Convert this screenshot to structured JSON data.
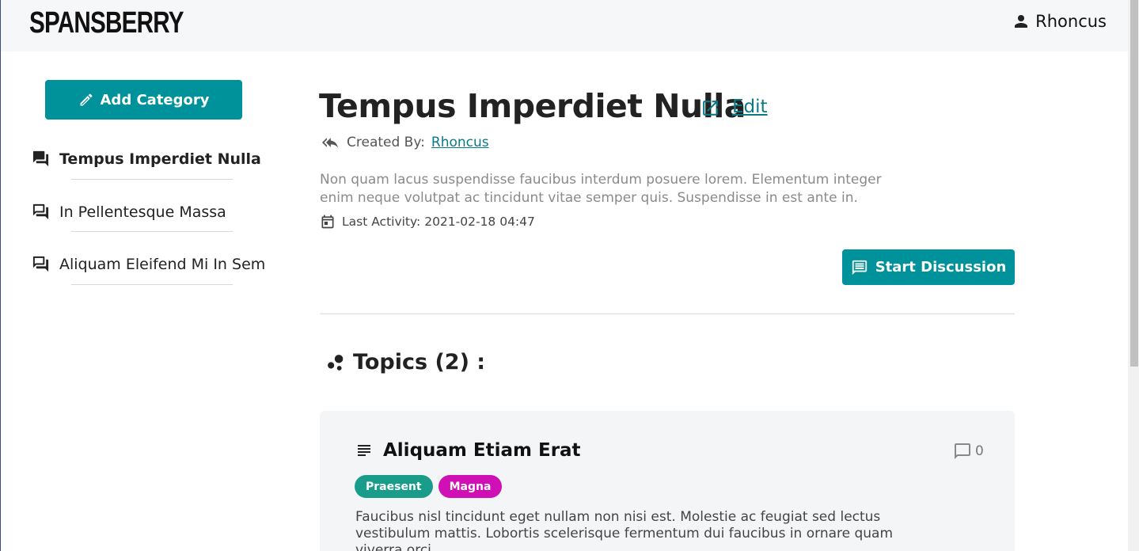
{
  "header": {
    "logo": "SPANSBERRY",
    "username": "Rhoncus"
  },
  "sidebar": {
    "add_category_label": "Add Category",
    "items": [
      {
        "label": "Tempus Imperdiet Nulla",
        "active": true
      },
      {
        "label": "In Pellentesque Massa",
        "active": false
      },
      {
        "label": "Aliquam Eleifend Mi In Sem",
        "active": false
      }
    ]
  },
  "category": {
    "title": "Tempus Imperdiet Nulla",
    "edit_label": "Edit",
    "created_by_label": "Created By:",
    "created_by_user": "Rhoncus",
    "description": "Non quam lacus suspendisse faucibus interdum posuere lorem. Elementum integer enim neque volutpat ac tincidunt vitae semper quis. Suspendisse in est ante in.",
    "last_activity_label": "Last Activity: 2021-02-18 04:47",
    "start_discussion_label": "Start Discussion"
  },
  "topics": {
    "heading": "Topics (2) :",
    "items": [
      {
        "title": "Aliquam Etiam Erat",
        "comment_count": "0",
        "tags": [
          {
            "label": "Praesent",
            "color": "#1a9c8a"
          },
          {
            "label": "Magna",
            "color": "#d010b4"
          }
        ],
        "description": "Faucibus nisl tincidunt eget nullam non nisi est. Molestie ac feugiat sed lectus vestibulum mattis. Lobortis scelerisque fermentum dui faucibus in ornare quam viverra orci."
      }
    ]
  },
  "colors": {
    "accent": "#00929b",
    "link": "#0a7a86"
  }
}
